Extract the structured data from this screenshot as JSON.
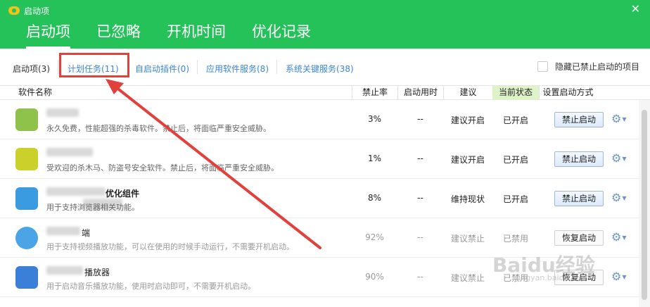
{
  "window": {
    "title": "启动项"
  },
  "tabs": [
    {
      "label": "启动项",
      "active": true
    },
    {
      "label": "已忽略"
    },
    {
      "label": "开机时间"
    },
    {
      "label": "优化记录"
    }
  ],
  "subtabs": [
    {
      "label": "启动项(3)"
    },
    {
      "label": "计划任务(11)"
    },
    {
      "label": "自启动插件(0)"
    },
    {
      "label": "应用软件服务(8)"
    },
    {
      "label": "系统关键服务(38)"
    }
  ],
  "hide_option": {
    "label": "隐藏已禁止启动的项目",
    "checked": false
  },
  "table": {
    "columns": [
      "软件名称",
      "禁止率",
      "启动用时",
      "建议",
      "当前状态",
      "设置启动方式"
    ],
    "rows": [
      {
        "name": "",
        "desc": "永久免费，性能超强的杀毒软件。禁止后，将面临严重安全威胁。",
        "ban_rate": "3%",
        "time": "--",
        "advice": "建议开启",
        "status": "已开启",
        "action": "禁止启动",
        "disabled": false,
        "icon_color": "#8fc24a"
      },
      {
        "name": "",
        "desc": "受欢迎的杀木马、防盗号安全软件。禁止后，将面临严重安全威胁。",
        "ban_rate": "1%",
        "time": "--",
        "advice": "建议开启",
        "status": "已开启",
        "action": "禁止启动",
        "disabled": false,
        "icon_color": "#c9d12a"
      },
      {
        "name": "优化组件",
        "desc": "用于支持浏览器相关功能。",
        "ban_rate": "8%",
        "time": "--",
        "advice": "维持现状",
        "status": "已开启",
        "action": "禁止启动",
        "disabled": false,
        "icon_color": "#3a9be0"
      },
      {
        "name": "端",
        "desc": "用于支持视频播放功能，可以在使用的时候手动运行，不需要开机启动。",
        "ban_rate": "92%",
        "time": "--",
        "advice": "建议禁止",
        "status": "已禁用",
        "action": "恢复启动",
        "disabled": true,
        "icon_color": "#4aa4e6"
      },
      {
        "name": "播放器",
        "desc": "用于启动音乐播放功能，使用时启动即可，不需要开机启动。",
        "ban_rate": "90%",
        "time": "--",
        "advice": "建议禁止",
        "status": "已禁用",
        "action": "恢复启动",
        "disabled": true,
        "icon_color": "#3b7fd8"
      }
    ]
  },
  "watermark": {
    "main": "Baidu经验",
    "sub": "jingyan.baidu.com"
  },
  "colors": {
    "header": "#25c25a",
    "link": "#3b86d4",
    "annotation": "#e2403b"
  }
}
